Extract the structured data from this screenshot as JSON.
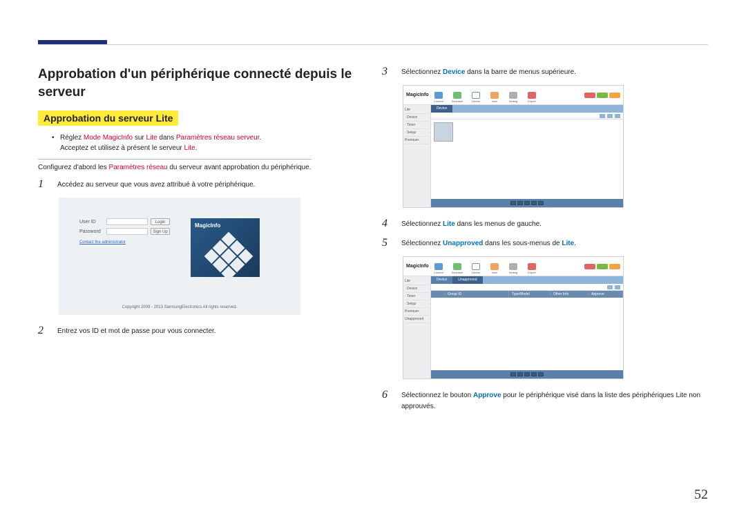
{
  "page_number": "52",
  "main_title": "Approbation d'un périphérique connecté depuis le serveur",
  "sub_title": "Approbation du serveur Lite",
  "bullet": {
    "prefix": "Réglez ",
    "bold1": "Mode MagicInfo",
    "mid1": " sur ",
    "bold2": "Lite",
    "mid2": " dans ",
    "bold3": "Paramètres réseau serveur",
    "end": ".",
    "line2_a": "Acceptez et utilisez à présent le serveur ",
    "line2_b": "Lite",
    "line2_c": "."
  },
  "note": {
    "prefix": "Configurez d'abord les ",
    "bold": "Paramètres réseau",
    "suffix": " du serveur avant approbation du périphérique."
  },
  "steps": {
    "s1": {
      "num": "1",
      "text": "Accédez au serveur que vous avez attribué à votre périphérique."
    },
    "s2": {
      "num": "2",
      "text": "Entrez vos ID et mot de passe pour vous connecter."
    },
    "s3": {
      "num": "3",
      "text_a": "Sélectionnez ",
      "kw": "Device",
      "text_b": " dans la barre de menus supérieure."
    },
    "s4": {
      "num": "4",
      "text_a": "Sélectionnez ",
      "kw": "Lite",
      "text_b": " dans les menus de gauche."
    },
    "s5": {
      "num": "5",
      "text_a": "Sélectionnez ",
      "kw": "Unapproved",
      "text_b": " dans les sous-menus de ",
      "kw2": "Lite",
      "text_c": "."
    },
    "s6": {
      "num": "6",
      "text_a": "Sélectionnez le bouton ",
      "kw": "Approve",
      "text_b": " pour le périphérique visé dans la liste des périphériques Lite non approuvés."
    }
  },
  "login": {
    "user_label": "User ID",
    "pass_label": "Password",
    "login_btn": "Login",
    "signup_btn": "Sign Up",
    "contact": "Contact the administrator",
    "logo": "MagicInfo",
    "copyright": "Copyright 2009 - 2013 SamsungElectronics All rights reserved."
  },
  "app": {
    "logo": "MagicInfo",
    "nav": {
      "content": "Content",
      "schedule": "Schedule",
      "device": "Device",
      "user": "User",
      "setting": "Setting",
      "export": "Export"
    },
    "side": {
      "lite": "Lite",
      "device": "· Device",
      "timer": "· Timer",
      "setup": "· Setup",
      "premium": "Premium",
      "unapproved": "Unapproved"
    },
    "tab_device": "Device",
    "tab_unapproved": "Unapproved",
    "table": {
      "group": "Group ID",
      "type": "Type/Model",
      "other": "Other Info",
      "approve": "Approve"
    }
  }
}
